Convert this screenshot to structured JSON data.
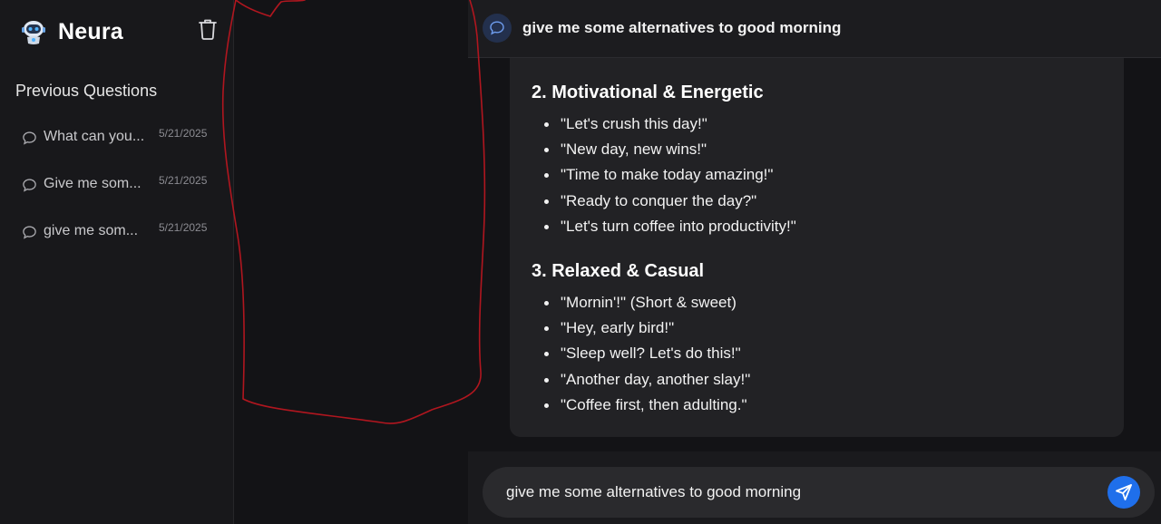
{
  "app": {
    "name": "Neura"
  },
  "sidebar": {
    "section_title": "Previous Questions",
    "items": [
      {
        "label": "What can you...",
        "date": "5/21/2025"
      },
      {
        "label": "Give me som...",
        "date": "5/21/2025"
      },
      {
        "label": "give me som...",
        "date": "5/21/2025"
      }
    ]
  },
  "header": {
    "question": "give me some alternatives to good morning"
  },
  "answer": {
    "sections": [
      {
        "heading": "2. Motivational & Energetic",
        "items": [
          "\"Let's crush this day!\"",
          "\"New day, new wins!\"",
          "\"Time to make today amazing!\"",
          "\"Ready to conquer the day?\"",
          "\"Let's turn coffee into productivity!\""
        ]
      },
      {
        "heading": "3. Relaxed & Casual",
        "items": [
          "\"Mornin'!\" (Short & sweet)",
          "\"Hey, early bird!\"",
          "\"Sleep well? Let's do this!\"",
          "\"Another day, another slay!\"",
          "\"Coffee first, then adulting.\""
        ]
      }
    ]
  },
  "composer": {
    "value": "give me some alternatives to good morning"
  },
  "icons": {
    "logo": "robot-logo-icon",
    "trash": "trash-icon",
    "history": "chat-bubble-icon",
    "send": "send-icon"
  },
  "colors": {
    "accent": "#1f6feb",
    "annotation": "#b0161f"
  }
}
